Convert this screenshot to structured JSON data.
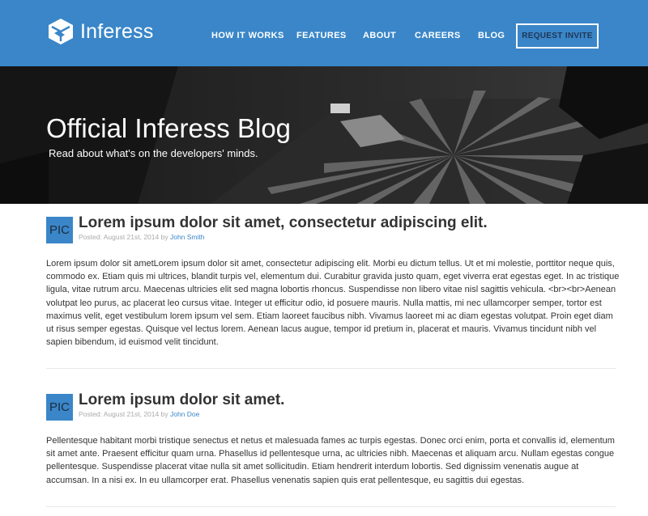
{
  "brand": {
    "name": "Inferess"
  },
  "nav": {
    "items": [
      "HOW IT WORKS",
      "FEATURES",
      "ABOUT",
      "CAREERS",
      "BLOG"
    ],
    "cta": "REQUEST INVITE"
  },
  "hero": {
    "title": "Official Inferess Blog",
    "subtitle": "Read about what's on the developers' minds."
  },
  "posts": [
    {
      "avatar": "PIC",
      "title": "Lorem ipsum dolor sit amet, consectetur adipiscing elit.",
      "meta_prefix": "Posted: August 21st, 2014 by",
      "author": "John Smith",
      "body": "Lorem ipsum dolor sit ametLorem ipsum dolor sit amet, consectetur adipiscing elit. Morbi eu dictum tellus. Ut et mi molestie, porttitor neque quis, commodo ex. Etiam quis mi ultrices, blandit turpis vel, elementum dui. Curabitur gravida justo quam, eget viverra erat egestas eget. In ac tristique ligula, vitae rutrum arcu. Maecenas ultricies elit sed magna lobortis rhoncus. Suspendisse non libero vitae nisl sagittis vehicula. <br><br>Aenean volutpat leo purus, ac placerat leo cursus vitae. Integer ut efficitur odio, id posuere mauris. Nulla mattis, mi nec ullamcorper semper, tortor est maximus velit, eget vestibulum lorem ipsum vel sem. Etiam laoreet faucibus nibh. Vivamus laoreet mi ac diam egestas volutpat. Proin eget diam ut risus semper egestas. Quisque vel lectus lorem. Aenean lacus augue, tempor id pretium in, placerat et mauris. Vivamus tincidunt nibh vel sapien bibendum, id euismod velit tincidunt."
    },
    {
      "avatar": "PIC",
      "title": "Lorem ipsum dolor sit amet.",
      "meta_prefix": "Posted: August 21st, 2014 by",
      "author": "John Doe",
      "body": "Pellentesque habitant morbi tristique senectus et netus et malesuada fames ac turpis egestas. Donec orci enim, porta et convallis id, elementum sit amet ante. Praesent efficitur quam urna. Phasellus id pellentesque urna, ac ultricies nibh. Maecenas et aliquam arcu. Nullam egestas congue pellentesque. Suspendisse placerat vitae nulla sit amet sollicitudin. Etiam hendrerit interdum lobortis. Sed dignissim venenatis augue at accumsan. In a nisi ex. In eu ullamcorper erat. Phasellus venenatis sapien quis erat pellentesque, eu sagittis dui egestas."
    }
  ],
  "colors": {
    "primary": "#3a86c8",
    "text": "#333333",
    "meta": "#aaaaaa"
  },
  "icons": {
    "logo": "inferess-cube-logo-icon"
  }
}
